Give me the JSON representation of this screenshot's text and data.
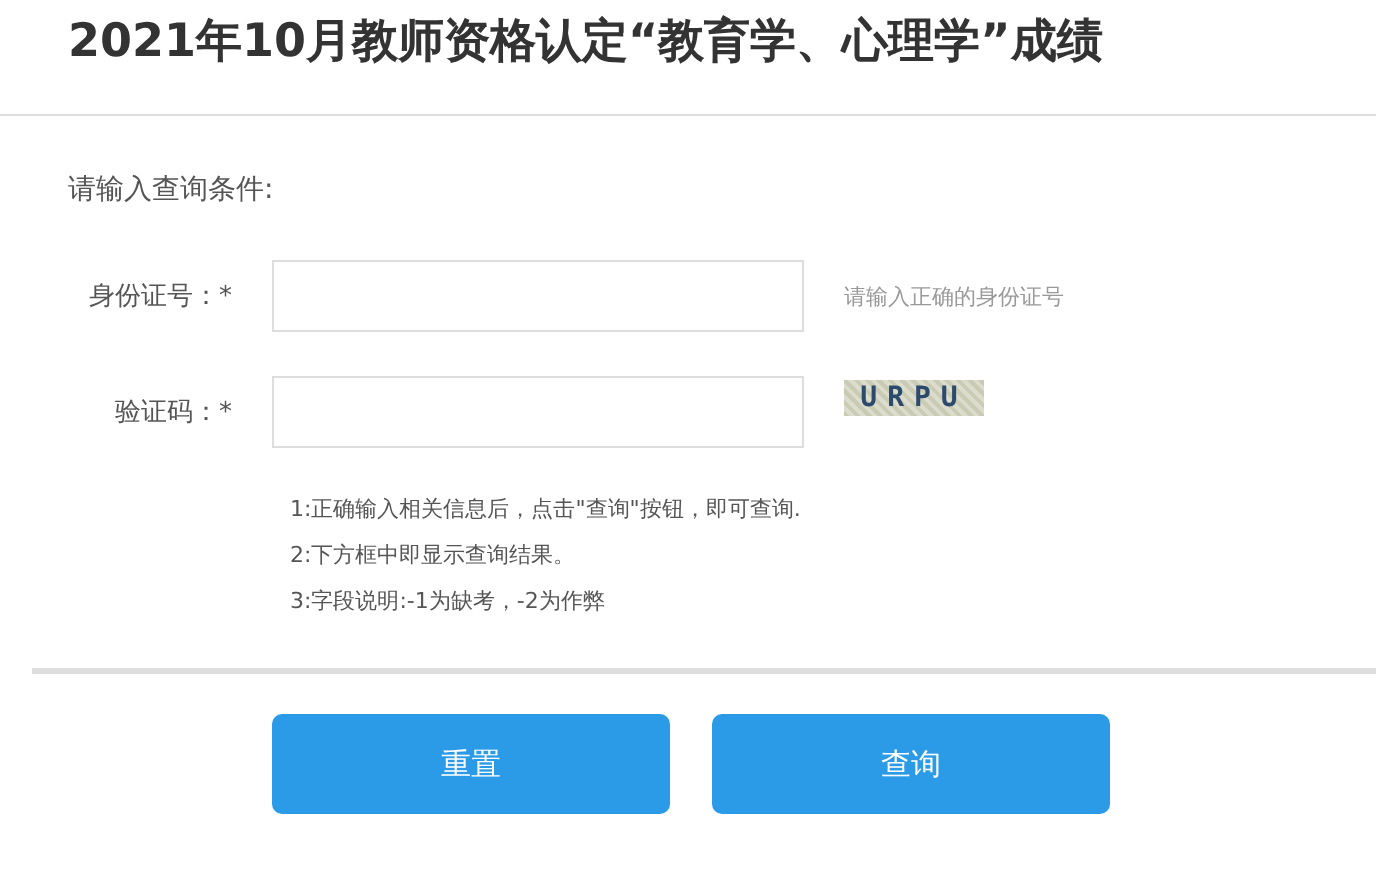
{
  "title": "2021年10月教师资格认定“教育学、心理学”成绩",
  "prompt": "请输入查询条件:",
  "fields": [
    {
      "label": "身份证号：*",
      "hint": "请输入正确的身份证号",
      "kind": "text"
    },
    {
      "label": "验证码：*",
      "captcha": "URPU",
      "kind": "captcha"
    }
  ],
  "notes": [
    "1:正确输入相关信息后，点击\"查询\"按钮，即可查询.",
    "2:下方框中即显示查询结果。",
    "3:字段说明:-1为缺考，-2为作弊"
  ],
  "buttons": [
    "重置",
    "查询"
  ]
}
